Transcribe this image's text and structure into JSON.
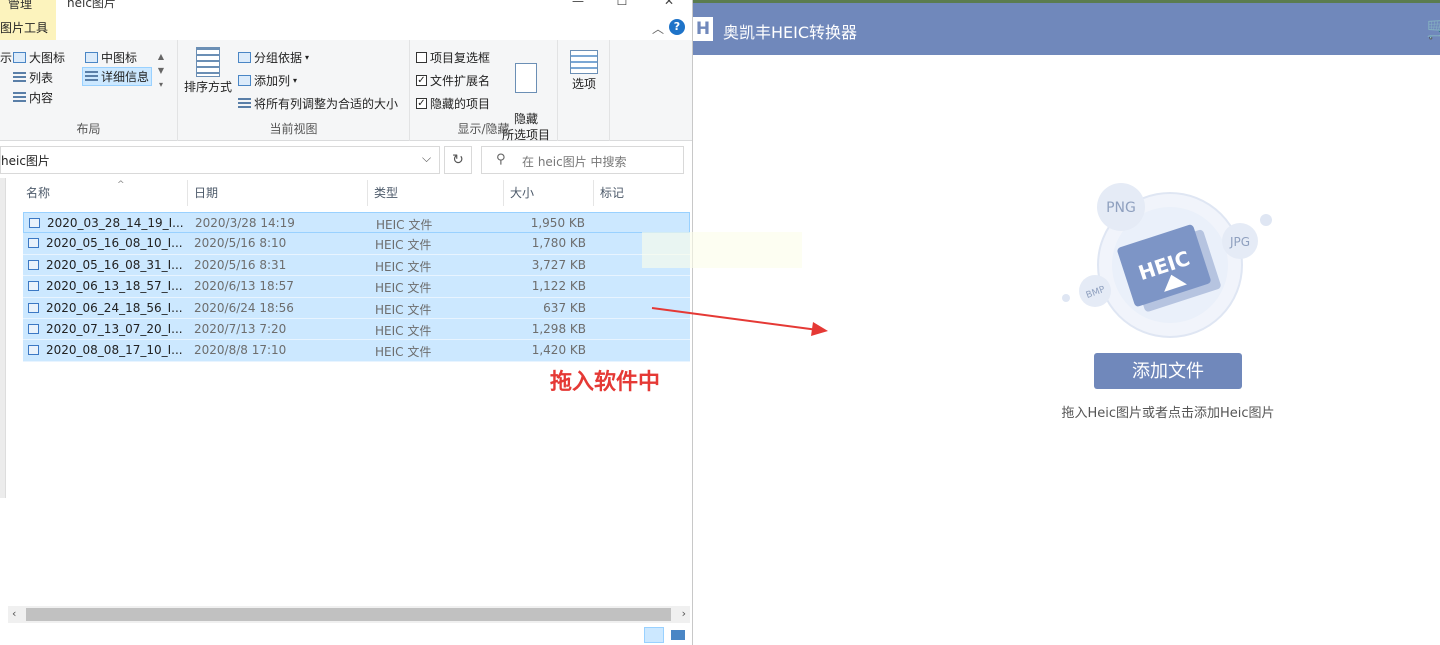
{
  "explorer": {
    "title": "heic图片",
    "tab_manage": "管理",
    "tab_pictool": "图片工具",
    "window_controls": [
      "—",
      "☐",
      "✕"
    ],
    "ribbon": {
      "layout": {
        "items": [
          "示",
          "大图标",
          "中图标",
          "列表",
          "详细信息",
          "内容"
        ],
        "label": "布局"
      },
      "current_view": {
        "sort": "排序方式",
        "group_by": "分组依据",
        "add_column": "添加列",
        "fit_columns": "将所有列调整为合适的大小",
        "label": "当前视图"
      },
      "show_hide": {
        "item_checkboxes": "项目复选框",
        "item_checkboxes_checked": false,
        "file_extensions": "文件扩展名",
        "file_extensions_checked": true,
        "hidden_items": "隐藏的项目",
        "hidden_items_checked": true,
        "hide_selected": "隐藏\n所选项目",
        "label": "显示/隐藏"
      },
      "options": "选项"
    },
    "address": "heic图片",
    "search_placeholder": "在 heic图片 中搜索",
    "columns": [
      "名称",
      "日期",
      "类型",
      "大小",
      "标记"
    ],
    "files": [
      {
        "name": "2020_03_28_14_19_I...",
        "date": "2020/3/28 14:19",
        "type": "HEIC 文件",
        "size": "1,950 KB"
      },
      {
        "name": "2020_05_16_08_10_I...",
        "date": "2020/5/16 8:10",
        "type": "HEIC 文件",
        "size": "1,780 KB"
      },
      {
        "name": "2020_05_16_08_31_I...",
        "date": "2020/5/16 8:31",
        "type": "HEIC 文件",
        "size": "3,727 KB"
      },
      {
        "name": "2020_06_13_18_57_I...",
        "date": "2020/6/13 18:57",
        "type": "HEIC 文件",
        "size": "1,122 KB"
      },
      {
        "name": "2020_06_24_18_56_I...",
        "date": "2020/6/24 18:56",
        "type": "HEIC 文件",
        "size": "637 KB"
      },
      {
        "name": "2020_07_13_07_20_I...",
        "date": "2020/7/13 7:20",
        "type": "HEIC 文件",
        "size": "1,298 KB"
      },
      {
        "name": "2020_08_08_17_10_I...",
        "date": "2020/8/8 17:10",
        "type": "HEIC 文件",
        "size": "1,420 KB"
      }
    ]
  },
  "annotation": {
    "text": "拖入软件中",
    "color": "#e53935"
  },
  "app": {
    "logo": "H",
    "title": "奥凯丰HEIC转换器",
    "accent": "#7088bb",
    "illustration": {
      "badge": "HEIC",
      "formats": [
        "PNG",
        "JPG",
        "BMP"
      ]
    },
    "add_button": "添加文件",
    "hint": "拖入Heic图片或者点击添加Heic图片"
  }
}
